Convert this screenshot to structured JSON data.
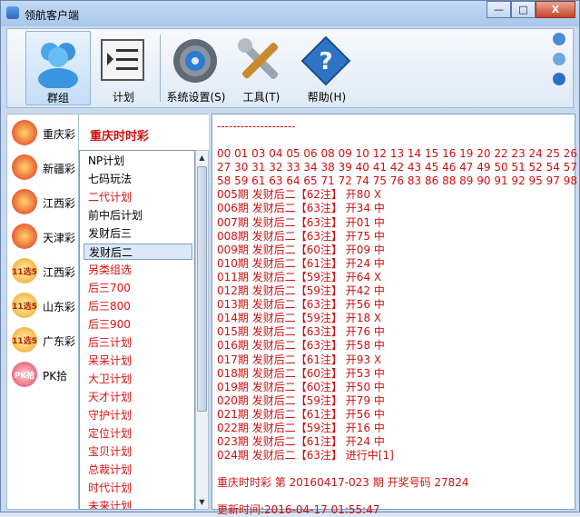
{
  "window": {
    "title": "领航客户端",
    "btn_min": "—",
    "btn_max": "□",
    "btn_close": "X"
  },
  "toolbar": {
    "items": [
      {
        "label": "群组",
        "icon": "people-icon"
      },
      {
        "label": "计划",
        "icon": "list-icon"
      },
      {
        "label": "系统设置(S)",
        "icon": "gear-icon"
      },
      {
        "label": "工具(T)",
        "icon": "tools-icon"
      },
      {
        "label": "帮助(H)",
        "icon": "help-icon"
      }
    ]
  },
  "lotteries": [
    {
      "name": "重庆彩",
      "badge": ""
    },
    {
      "name": "新疆彩",
      "badge": ""
    },
    {
      "name": "江西彩",
      "badge": ""
    },
    {
      "name": "天津彩",
      "badge": ""
    },
    {
      "name": "江西彩",
      "badge": "11选5"
    },
    {
      "name": "山东彩",
      "badge": "11选5"
    },
    {
      "name": "广东彩",
      "badge": "11选5"
    },
    {
      "name": "PK拾",
      "badge": "PK拾"
    }
  ],
  "panel_title": "重庆时时彩",
  "plans": [
    {
      "label": "NP计划",
      "red": false
    },
    {
      "label": "七码玩法",
      "red": false
    },
    {
      "label": "二代计划",
      "red": true
    },
    {
      "label": "前中后计划",
      "red": false
    },
    {
      "label": "发财后三",
      "red": false
    },
    {
      "label": "发财后二",
      "red": false,
      "selected": true
    },
    {
      "label": "另类组选",
      "red": true
    },
    {
      "label": "后三700",
      "red": true
    },
    {
      "label": "后三800",
      "red": true
    },
    {
      "label": "后三900",
      "red": true
    },
    {
      "label": "后三计划",
      "red": true
    },
    {
      "label": "呆呆计划",
      "red": true
    },
    {
      "label": "大卫计划",
      "red": true
    },
    {
      "label": "天才计划",
      "red": true
    },
    {
      "label": "守护计划",
      "red": true
    },
    {
      "label": "定位计划",
      "red": true
    },
    {
      "label": "宝贝计划",
      "red": true
    },
    {
      "label": "总裁计划",
      "red": true
    },
    {
      "label": "时代计划",
      "red": true
    },
    {
      "label": "未来计划",
      "red": true
    }
  ],
  "content": {
    "divider": "--------------------",
    "numbers": [
      "00 01 03 04 05 06 08 09 10 12 13 14 15 16 19 20 22 23 24 25 26",
      "27 30 31 32 33 34 38 39 40 41 42 43 45 46 47 49 50 51 52 54 57",
      "58 59 61 63 64 65 71 72 74 75 76 83 86 88 89 90 91 92 95 97 98"
    ],
    "records": [
      "005期 发财后二【62注】 开80 X",
      "006期 发财后二【63注】 开34 中",
      "007期 发财后二【63注】 开01 中",
      "008期 发财后二【63注】 开75 中",
      "009期 发财后二【60注】 开09 中",
      "010期 发财后二【61注】 开24 中",
      "011期 发财后二【59注】 开64 X",
      "012期 发财后二【59注】 开42 中",
      "013期 发财后二【63注】 开56 中",
      "014期 发财后二【59注】 开18 X",
      "015期 发财后二【63注】 开76 中",
      "016期 发财后二【63注】 开58 中",
      "017期 发财后二【61注】 开93 X",
      "018期 发财后二【60注】 开53 中",
      "019期 发财后二【60注】 开50 中",
      "020期 发财后二【59注】 开79 中",
      "021期 发财后二【61注】 开56 中",
      "022期 发财后二【59注】 开16 中",
      "023期 发财后二【61注】 开24 中",
      "024期 发财后二【63注】 进行中[1]"
    ],
    "result_line": "重庆时时彩 第 20160417-023 期 开奖号码 27824",
    "update_line": "更新时间:2016-04-17 01:55:47"
  },
  "colors": {
    "accent_red": "#d01010",
    "window_bg": "#c9d9ee"
  }
}
